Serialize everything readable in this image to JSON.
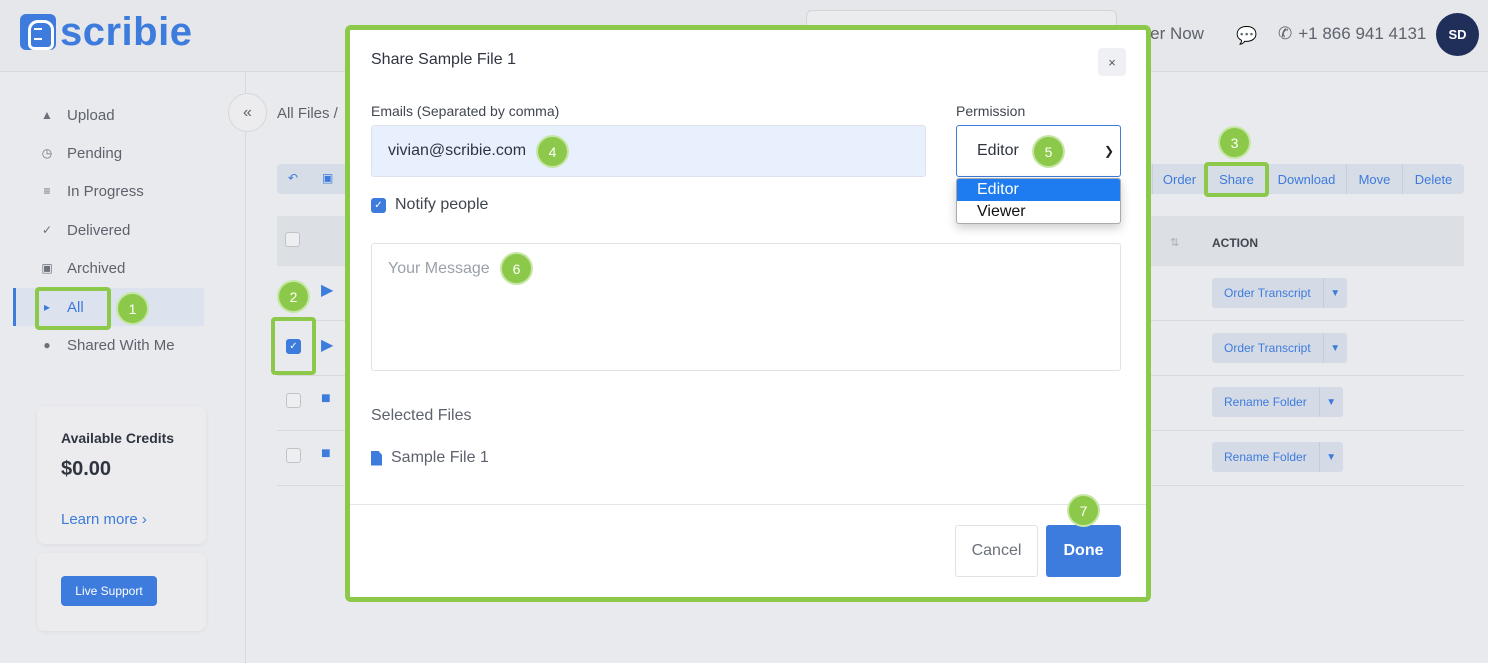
{
  "header": {
    "logo_text": "scribie",
    "order_now": "rder Now",
    "phone": "+1 866 941 4131",
    "avatar_initials": "SD",
    "icons": [
      "chat-icon",
      "phone-icon"
    ]
  },
  "sidebar": {
    "items": [
      {
        "label": "Upload",
        "icon": "upload-icon"
      },
      {
        "label": "Pending",
        "icon": "clock-icon"
      },
      {
        "label": "In Progress",
        "icon": "list-icon"
      },
      {
        "label": "Delivered",
        "icon": "check-icon"
      },
      {
        "label": "Archived",
        "icon": "archive-icon"
      },
      {
        "label": "All",
        "icon": "caret-right-icon",
        "active": true
      },
      {
        "label": "Shared With Me",
        "icon": "users-icon"
      }
    ],
    "credits": {
      "title": "Available Credits",
      "value": "$0.00",
      "learn_more": "Learn more"
    },
    "support_label": "Live Support"
  },
  "main": {
    "breadcrumb": "All Files  /",
    "toolbar": {
      "buttons": [
        "Order",
        "Share",
        "Download",
        "Move",
        "Delete"
      ]
    },
    "table": {
      "action_header": "ACTION",
      "rows": [
        {
          "type": "file",
          "action": "Order Transcript",
          "checked": false
        },
        {
          "type": "file",
          "action": "Order Transcript",
          "checked": true
        },
        {
          "type": "folder",
          "action": "Rename Folder",
          "checked": false
        },
        {
          "type": "folder",
          "action": "Rename Folder",
          "checked": false
        }
      ]
    }
  },
  "modal": {
    "title": "Share Sample File 1",
    "emails_label": "Emails (Separated by comma)",
    "emails_value": "vivian@scribie.com",
    "permission_label": "Permission",
    "permission_value": "Editor",
    "permission_options": [
      "Editor",
      "Viewer"
    ],
    "notify_label": "Notify people",
    "notify_checked": true,
    "message_placeholder": "Your Message",
    "selected_files_label": "Selected Files",
    "selected_files": [
      "Sample File 1"
    ],
    "cancel_label": "Cancel",
    "done_label": "Done",
    "close_glyph": "×"
  },
  "annotations": {
    "highlight_color": "#8cc94a",
    "steps": [
      "1",
      "2",
      "3",
      "4",
      "5",
      "6",
      "7"
    ]
  },
  "colors": {
    "accent": "#3d7bdc",
    "select_highlight": "#1e7cf0"
  }
}
